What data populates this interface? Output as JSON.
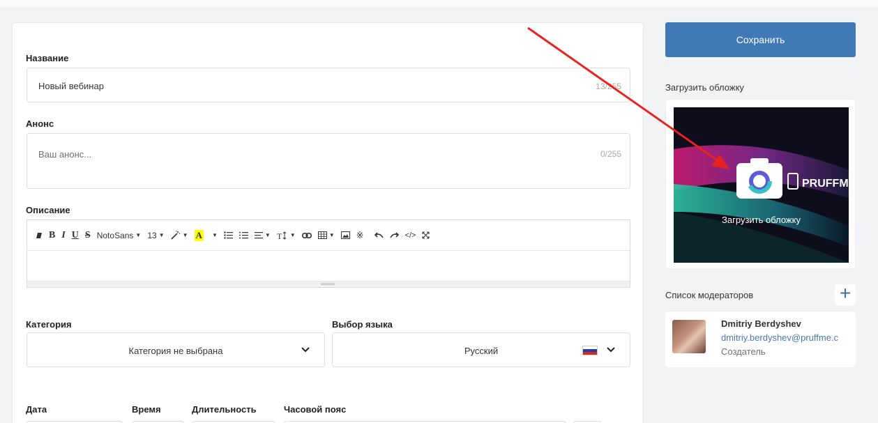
{
  "form": {
    "title_label": "Название",
    "title_value": "Новый вебинар",
    "title_counter": "13/255",
    "announce_label": "Анонс",
    "announce_placeholder": "Ваш анонс...",
    "announce_counter": "0/255",
    "description_label": "Описание",
    "editor": {
      "font_name": "NotoSans",
      "font_size": "13"
    },
    "category_label": "Категория",
    "category_value": "Категория не выбрана",
    "language_label": "Выбор языка",
    "language_value": "Русский",
    "date_label": "Дата",
    "time_label": "Время",
    "duration_label": "Длительность",
    "timezone_label": "Часовой пояс"
  },
  "sidebar": {
    "save_label": "Сохранить",
    "cover_label": "Загрузить обложку",
    "cover_caption": "Загрузить обложку",
    "cover_brand": "PRUFFM",
    "moderators_label": "Список модераторов",
    "moderator": {
      "name": "Dmitriy Berdyshev",
      "email": "dmitriy.berdyshev@pruffme.c",
      "role": "Создатель"
    }
  },
  "colors": {
    "primary": "#4079b5",
    "annotation_arrow": "#e8231f",
    "highlight": "#ffff00"
  },
  "icons": [
    "eraser-icon",
    "wand-icon",
    "list-icon",
    "link-icon",
    "table-icon",
    "image-icon",
    "undo-icon",
    "redo-icon",
    "code-icon",
    "fullscreen-icon",
    "camera-icon",
    "plus-icon",
    "chevron-down-icon",
    "flag-ru-icon"
  ]
}
